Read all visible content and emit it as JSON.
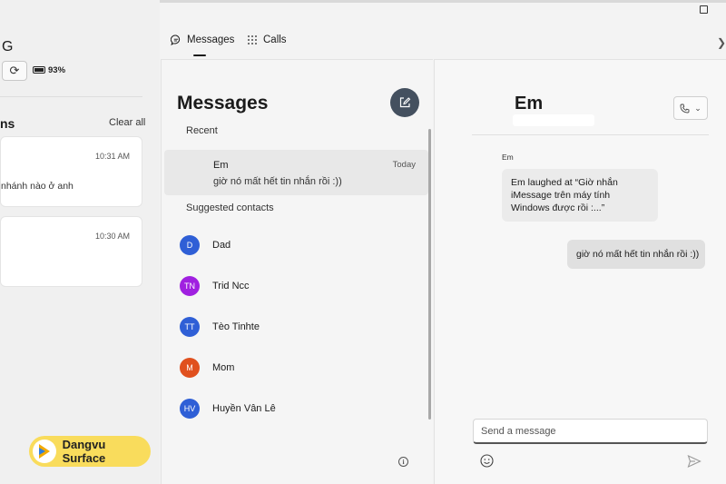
{
  "left_panel": {
    "title_fragment": "G",
    "battery": "93%",
    "heading_fragment": "ns",
    "clear_all": "Clear all",
    "cards": [
      {
        "time": "10:31 AM",
        "text": "nhánh nào ở anh"
      },
      {
        "time": "10:30 AM",
        "text": ""
      }
    ],
    "badge_text": "Dangvu Surface"
  },
  "tabs": [
    {
      "label": "Messages",
      "icon": "chat-icon",
      "selected": true
    },
    {
      "label": "Calls",
      "icon": "keypad-icon",
      "selected": false
    }
  ],
  "messages_list": {
    "title": "Messages",
    "recent_label": "Recent",
    "recent": [
      {
        "name": "Em",
        "date": "Today",
        "preview": "giờ nó mất hết tin nhắn rồi :))"
      }
    ],
    "suggested_label": "Suggested contacts",
    "contacts": [
      {
        "initials": "D",
        "name": "Dad",
        "color": "#2f5fd6"
      },
      {
        "initials": "TN",
        "name": "Trid Ncc",
        "color": "#a020e0"
      },
      {
        "initials": "TT",
        "name": "Tèo Tinhte",
        "color": "#2f5fd6"
      },
      {
        "initials": "M",
        "name": "Mom",
        "color": "#e0501e"
      },
      {
        "initials": "HV",
        "name": "Huyền Vân Lê",
        "color": "#2f5fd6"
      }
    ]
  },
  "conversation": {
    "name": "Em",
    "sender_label": "Em",
    "incoming": "Em laughed at “Giờ nhắn iMessage trên máy tính Windows được rồi :...”",
    "outgoing": "giờ nó mất hết tin nhắn rồi :))",
    "composer_placeholder": "Send a message"
  }
}
